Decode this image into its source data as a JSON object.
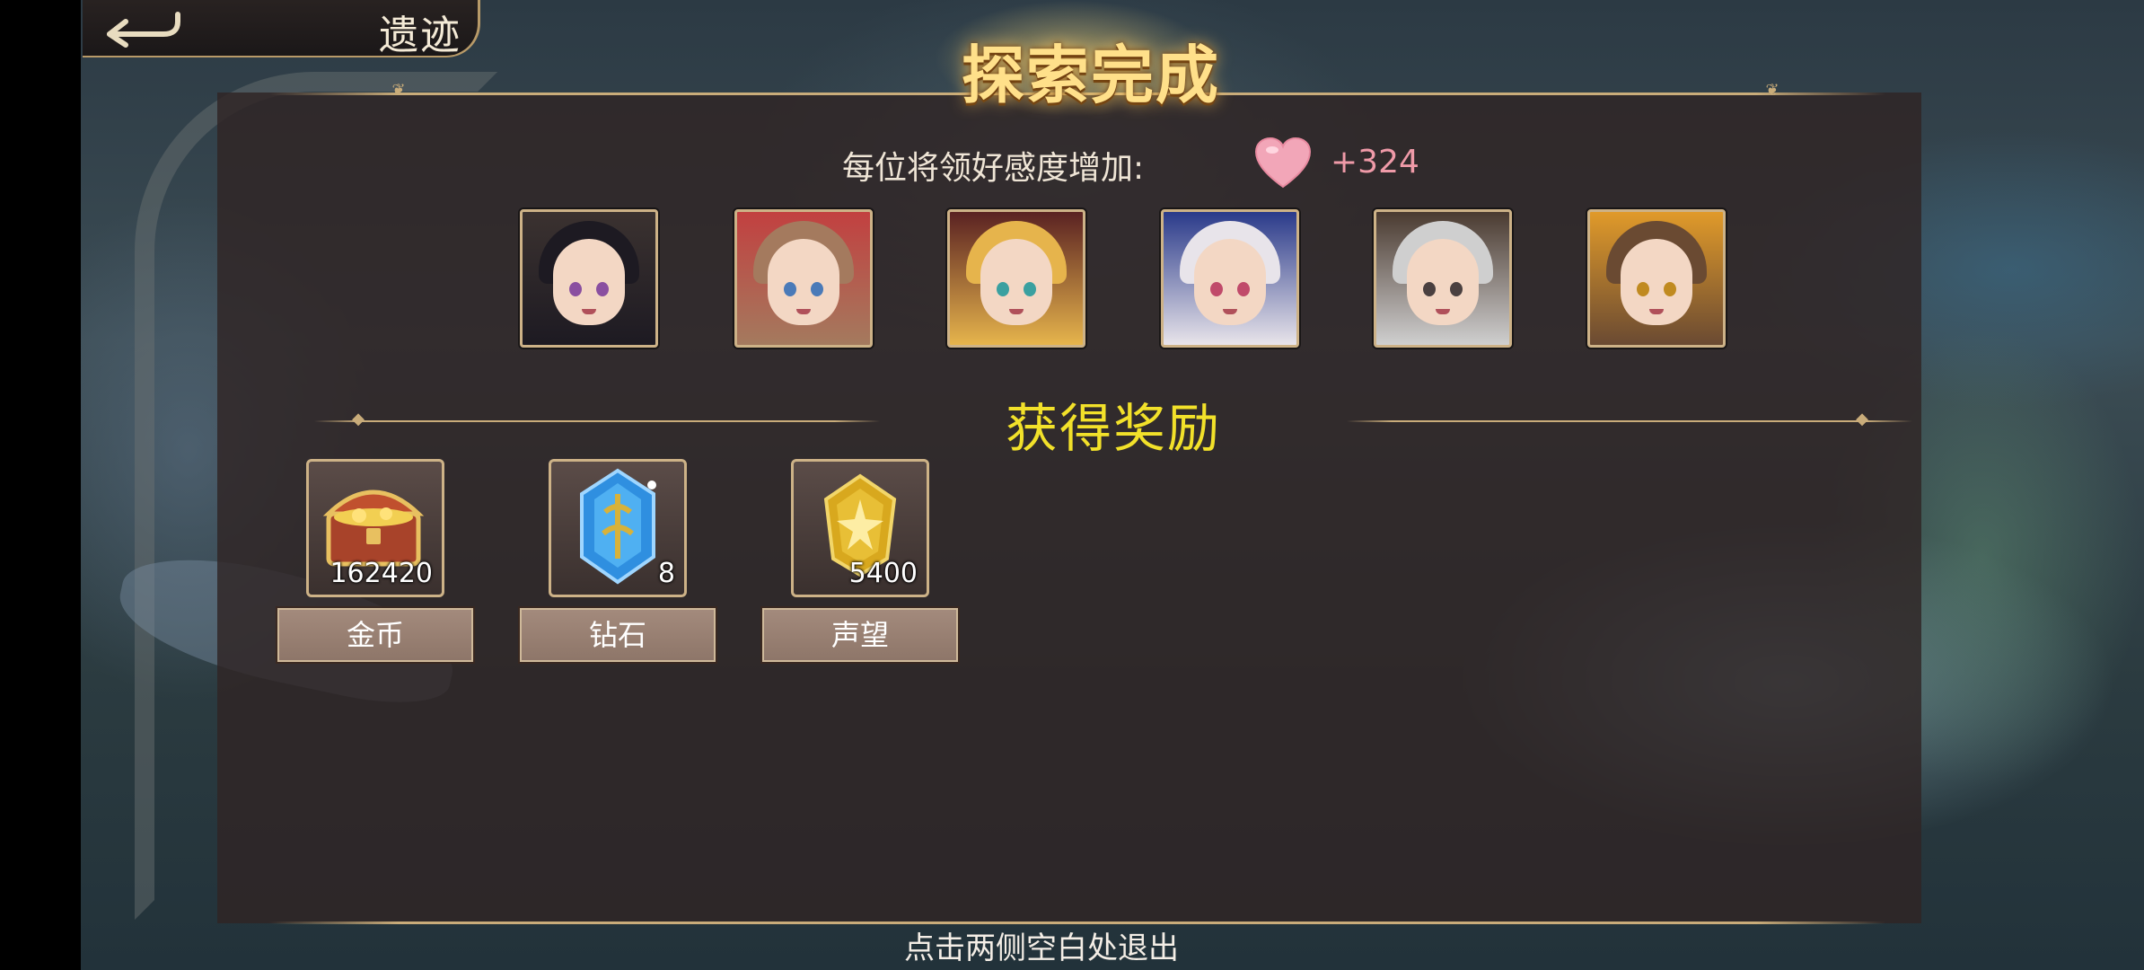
{
  "header": {
    "tab_title": "遗迹",
    "banner_title": "探索完成"
  },
  "affinity": {
    "label": "每位将领好感度增加:",
    "value": "+324",
    "icon": "heart-icon"
  },
  "heroes": [
    {
      "name": "hero-portrait-1",
      "hair": "#1d1a22",
      "hat": "#3b3230",
      "eyes": "#8a4fa0"
    },
    {
      "name": "hero-portrait-2",
      "hair": "#a47a5e",
      "hat": "#c24040",
      "eyes": "#4a7ab8"
    },
    {
      "name": "hero-portrait-3",
      "hair": "#e6b44c",
      "hat": "#5a2222",
      "eyes": "#3aa0a0"
    },
    {
      "name": "hero-portrait-4",
      "hair": "#e8e4ea",
      "hat": "#2a3a8a",
      "eyes": "#c04a6a"
    },
    {
      "name": "hero-portrait-5",
      "hair": "#cfcfcf",
      "hat": "#4a3a30",
      "eyes": "#4a4040"
    },
    {
      "name": "hero-portrait-6",
      "hair": "#6a4a32",
      "hat": "#e09a2a",
      "eyes": "#c08a20"
    }
  ],
  "rewards_title": "获得奖励",
  "rewards": [
    {
      "label": "金币",
      "count": "162420",
      "icon": "treasure-chest-icon"
    },
    {
      "label": "钻石",
      "count": "8",
      "icon": "diamond-crystal-icon"
    },
    {
      "label": "声望",
      "count": "5400",
      "icon": "reputation-medal-icon"
    }
  ],
  "exit_hint": "点击两侧空白处退出",
  "colors": {
    "gold_border": "#cdb287",
    "rewards_title": "#f2e12a",
    "affinity_value": "#ef9aa8"
  }
}
